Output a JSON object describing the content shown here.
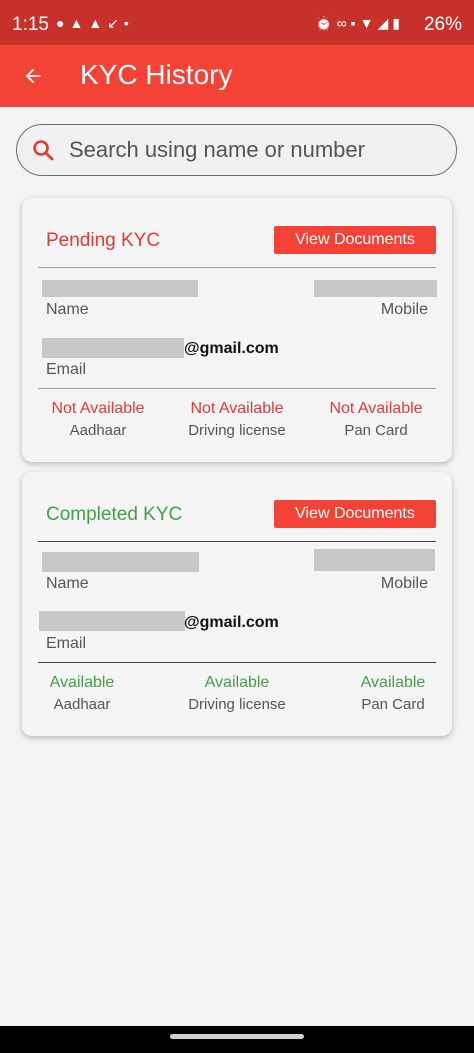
{
  "status_bar": {
    "time": "1:15",
    "battery": "26%",
    "left_icons": [
      "chat-icon",
      "snapchat-icon",
      "snapchat-icon",
      "missed-call-icon",
      "dot-icon"
    ],
    "right_icons": [
      "alarm-icon",
      "link-icon",
      "volte-icon",
      "wifi-icon",
      "lte-signal-icon",
      "battery-icon"
    ]
  },
  "app_bar": {
    "title": "KYC History",
    "back_icon": "arrow-left-icon"
  },
  "search": {
    "placeholder": "Search using name or number",
    "icon": "search-icon"
  },
  "cards": [
    {
      "status_title": "Pending KYC",
      "status_color": "#e53935",
      "button_label": "View Documents",
      "name_label": "Name",
      "mobile_label": "Mobile",
      "email_suffix": "@gmail.com",
      "email_label": "Email",
      "documents": [
        {
          "status": "Not Available",
          "name": "Aadhaar"
        },
        {
          "status": "Not Available",
          "name": "Driving license"
        },
        {
          "status": "Not Available",
          "name": "Pan Card"
        }
      ]
    },
    {
      "status_title": "Completed KYC",
      "status_color": "#43a047",
      "button_label": "View Documents",
      "name_label": "Name",
      "mobile_label": "Mobile",
      "email_suffix": "@gmail.com",
      "email_label": "Email",
      "documents": [
        {
          "status": "Available",
          "name": "Aadhaar"
        },
        {
          "status": "Available",
          "name": "Driving license"
        },
        {
          "status": "Available",
          "name": "Pan Card"
        }
      ]
    }
  ],
  "colors": {
    "accent": "#f44336",
    "status_bar": "#c6322a",
    "pending": "#e53935",
    "completed": "#43a047"
  }
}
